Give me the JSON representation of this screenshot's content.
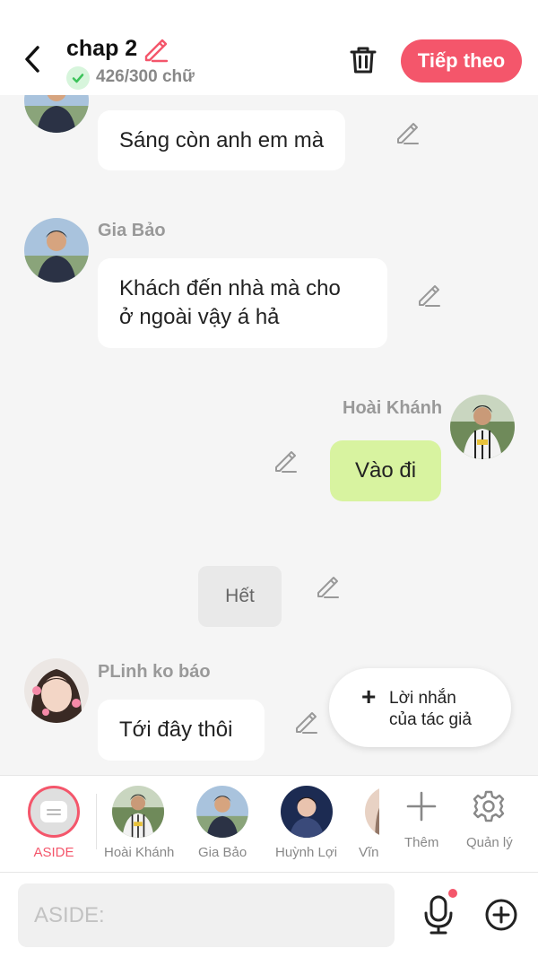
{
  "header": {
    "chapter_title": "chap 2",
    "word_count": "426/300 chữ",
    "next_label": "Tiếp theo"
  },
  "messages": [
    {
      "speaker": "",
      "text": "Sáng còn anh em mà"
    },
    {
      "speaker": "Gia Bảo",
      "text_line1": "Khách đến nhà mà cho",
      "text_line2": "ở ngoài vậy á hả"
    },
    {
      "speaker": "Hoài Khánh",
      "text": "Vào đi"
    },
    {
      "narration": "Hết"
    },
    {
      "speaker": "PLinh ko báo",
      "text": "Tới đây thôi"
    }
  ],
  "author_note": {
    "line1": "Lời nhắn",
    "line2": "của tác giả"
  },
  "characters": {
    "aside": "ASIDE",
    "list": [
      {
        "name": "Hoài Khánh"
      },
      {
        "name": "Gia Bảo"
      },
      {
        "name": "Huỳnh Lợi"
      },
      {
        "name": "Vĩn"
      }
    ],
    "add_label": "Thêm",
    "manage_label": "Quản lý"
  },
  "composer": {
    "placeholder": "ASIDE:"
  },
  "colors": {
    "accent": "#f4566b",
    "mine_bubble": "#d8f3a0",
    "check_green": "#3cc35a"
  }
}
